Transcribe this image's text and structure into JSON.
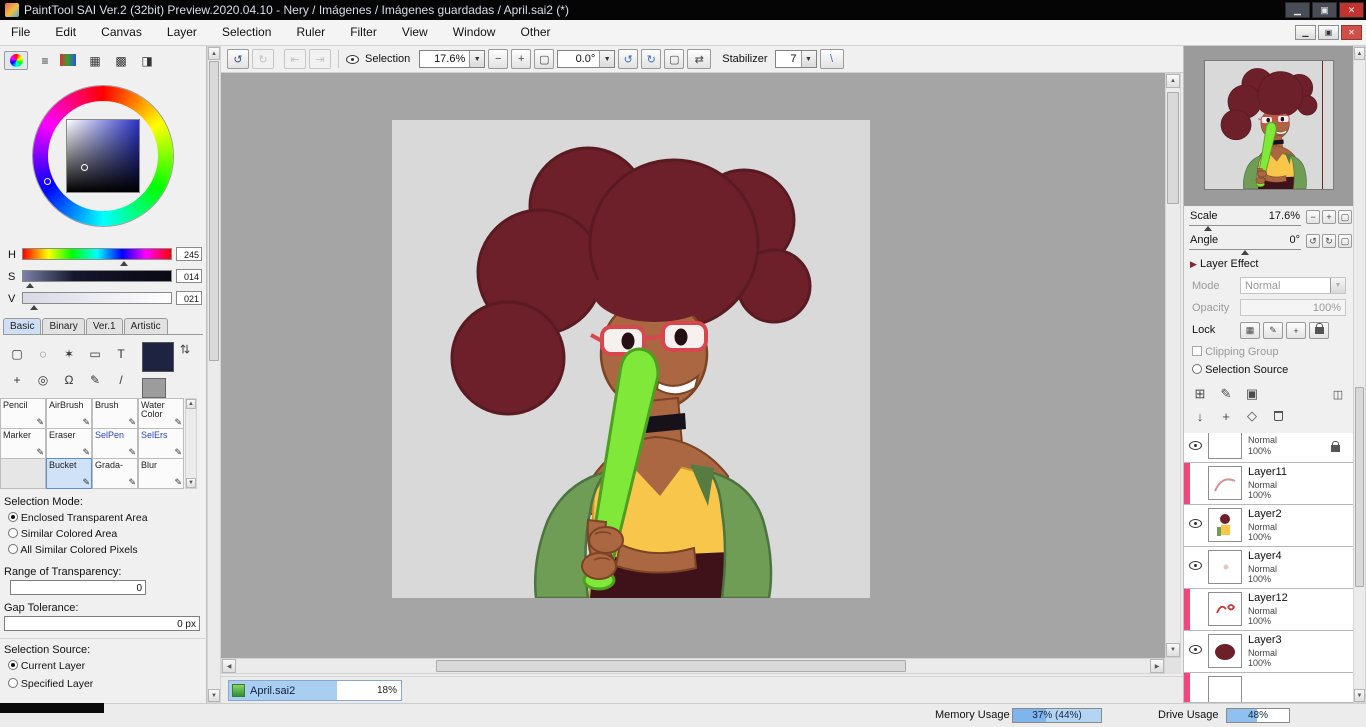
{
  "window": {
    "title": "PaintTool SAI Ver.2 (32bit) Preview.2020.04.10 - Nery / Imágenes / Imágenes guardadas / April.sai2 (*)"
  },
  "menubar": {
    "items": [
      "File",
      "Edit",
      "Canvas",
      "Layer",
      "Selection",
      "Ruler",
      "Filter",
      "View",
      "Window",
      "Other"
    ]
  },
  "toolbar": {
    "selection_label": "Selection",
    "zoom": "17.6%",
    "angle": "0.0°",
    "stabilizer_label": "Stabilizer",
    "stabilizer": "7"
  },
  "color_panel": {
    "h_label": "H",
    "h_value": "245",
    "s_label": "S",
    "s_value": "014",
    "v_label": "V",
    "v_value": "021",
    "tabs": [
      "Basic",
      "Binary",
      "Ver.1",
      "Artistic"
    ],
    "selected_tab": "Basic"
  },
  "tool_grid": {
    "row1": [
      "Pencil",
      "AirBrush",
      "Brush",
      "Water Color"
    ],
    "row2": [
      "Marker",
      "Eraser",
      "SelPen",
      "SelErs"
    ],
    "row3": [
      "",
      "Bucket",
      "Grada-",
      "Blur"
    ],
    "selected": "Bucket"
  },
  "selection_mode": {
    "title": "Selection Mode:",
    "options": [
      "Enclosed Transparent Area",
      "Similar Colored Area",
      "All Similar Colored Pixels"
    ],
    "selected": "Enclosed Transparent Area"
  },
  "range_of_transparency": {
    "label": "Range of Transparency:",
    "value": "0"
  },
  "gap_tolerance": {
    "label": "Gap Tolerance:",
    "value": "0 px"
  },
  "selection_source_panel": {
    "title": "Selection Source:",
    "options": [
      "Current Layer",
      "Specified Layer"
    ],
    "selected": "Current Layer"
  },
  "navigator": {
    "scale_label": "Scale",
    "scale_value": "17.6%",
    "angle_label": "Angle",
    "angle_value": "0°"
  },
  "layer_panel": {
    "header": "Layer Effect",
    "mode_label": "Mode",
    "mode_value": "Normal",
    "opacity_label": "Opacity",
    "opacity_value": "100%",
    "lock_label": "Lock",
    "clipping_group_label": "Clipping Group",
    "selection_source_label": "Selection Source",
    "layers": [
      {
        "name": "",
        "mode": "Normal",
        "opacity": "100%",
        "visible": true,
        "locked": true,
        "marker": false
      },
      {
        "name": "Layer11",
        "mode": "Normal",
        "opacity": "100%",
        "visible": false,
        "locked": false,
        "marker": true
      },
      {
        "name": "Layer2",
        "mode": "Normal",
        "opacity": "100%",
        "visible": true,
        "locked": false,
        "marker": false
      },
      {
        "name": "Layer4",
        "mode": "Normal",
        "opacity": "100%",
        "visible": true,
        "locked": false,
        "marker": false
      },
      {
        "name": "Layer12",
        "mode": "Normal",
        "opacity": "100%",
        "visible": false,
        "locked": false,
        "marker": true
      },
      {
        "name": "Layer3",
        "mode": "Normal",
        "opacity": "100%",
        "visible": true,
        "locked": false,
        "marker": false
      },
      {
        "name": "",
        "mode": "",
        "opacity": "",
        "visible": false,
        "locked": false,
        "marker": true
      }
    ]
  },
  "statusbar": {
    "document_tab": "April.sai2",
    "document_progress": "18%",
    "memory_label": "Memory Usage",
    "memory_value": "37% (44%)",
    "drive_label": "Drive Usage",
    "drive_value": "48%"
  },
  "colors": {
    "progress_blue": "#8fc0f0",
    "layer_marker_pink": "#f6447f",
    "hair": "#6d2029",
    "skin": "#aa6742",
    "jacket": "#6f9d55",
    "bat": "#7fe838",
    "shirt": "#f8c64b",
    "canvas_bg": "#d9d9d9"
  }
}
